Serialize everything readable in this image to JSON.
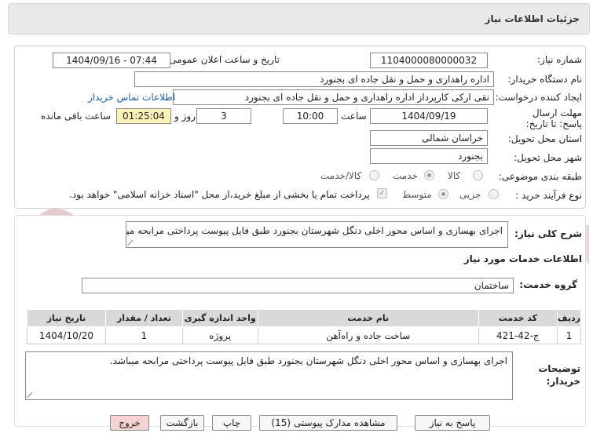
{
  "header": {
    "title": "جزئیات اطلاعات نیاز"
  },
  "form": {
    "need_number_label": "شماره نیاز:",
    "need_number": "1104000080000032",
    "announce_label": "تاریخ و ساعت اعلان عمومی:",
    "announce_value": "1404/09/16 - 07:44",
    "buyer_org_label": "نام دستگاه خریدار:",
    "buyer_org": "اداره راهداری و حمل و نقل جاده ای بجنورد",
    "requester_label": "ایجاد کننده درخواست:",
    "requester": "نقی ارکی کارپرداز اداره راهداری و حمل و نقل جاده ای بجنورد",
    "contact_link": "اطلاعات تماس خریدار",
    "deadline_label": "مهلت ارسال پاسخ: تا تاریخ:",
    "deadline_date": "1404/09/19",
    "time_label": "ساعت",
    "deadline_time": "10:00",
    "days_value": "3",
    "days_label": "روز و",
    "remaining_time": "01:25:04",
    "remaining_label": "ساعت باقی مانده",
    "province_label": "استان محل تحویل:",
    "province": "خراسان شمالی",
    "city_label": "شهر محل تحویل:",
    "city": "بجنورد",
    "category_label": "طبقه بندی موضوعی:",
    "category_options": [
      "کالا",
      "خدمت",
      "کالا/خدمت"
    ],
    "process_label": "نوع فرآیند خرید :",
    "process_options": [
      "جزیی",
      "متوسط"
    ],
    "payment_note": "پرداخت تمام یا بخشی از مبلغ خرید،از محل \"اسناد خزانه اسلامی\" خواهد بود."
  },
  "description": {
    "label": "شرح کلی نیاز:",
    "text": "اجرای بهسازی و اساس محور اخلی دنگل شهرستان بجنورد طبق فایل پیوست پرداختی مرابحه میباشد."
  },
  "services": {
    "section_title": "اطلاعات خدمات مورد نیاز",
    "group_label": "گروه خدمت:",
    "group_value": "ساختمان",
    "columns": [
      "ردیف",
      "کد خدمت",
      "نام خدمت",
      "واحد اندازه گیری",
      "تعداد / مقدار",
      "تاریخ نیاز"
    ],
    "rows": [
      [
        "1",
        "ج-42-421",
        "ساخت جاده و راه‌آهن",
        "پروژه",
        "1",
        "1404/10/20"
      ]
    ]
  },
  "buyer_notes": {
    "label": "توضیحات خریدار:",
    "text": "اجرای بهسازی و اساس محور اخلی دنگل شهرستان بجنورد طبق فایل پیوست پرداختی مرابحه میباشد."
  },
  "buttons": {
    "reply": "پاسخ به نیاز",
    "attachments": "مشاهده مدارک پیوستی (15)",
    "print": "چاپ",
    "back": "بازگشت",
    "exit": "خروج"
  },
  "watermark": {
    "text": "AriaTender.net"
  },
  "colors": {
    "header_bg": "#e9e9e9",
    "remaining_bg": "#fbf2b8",
    "link": "#1a5fb4",
    "exit_bg": "#f6d3d3",
    "watermark": "#e7c9c9"
  }
}
